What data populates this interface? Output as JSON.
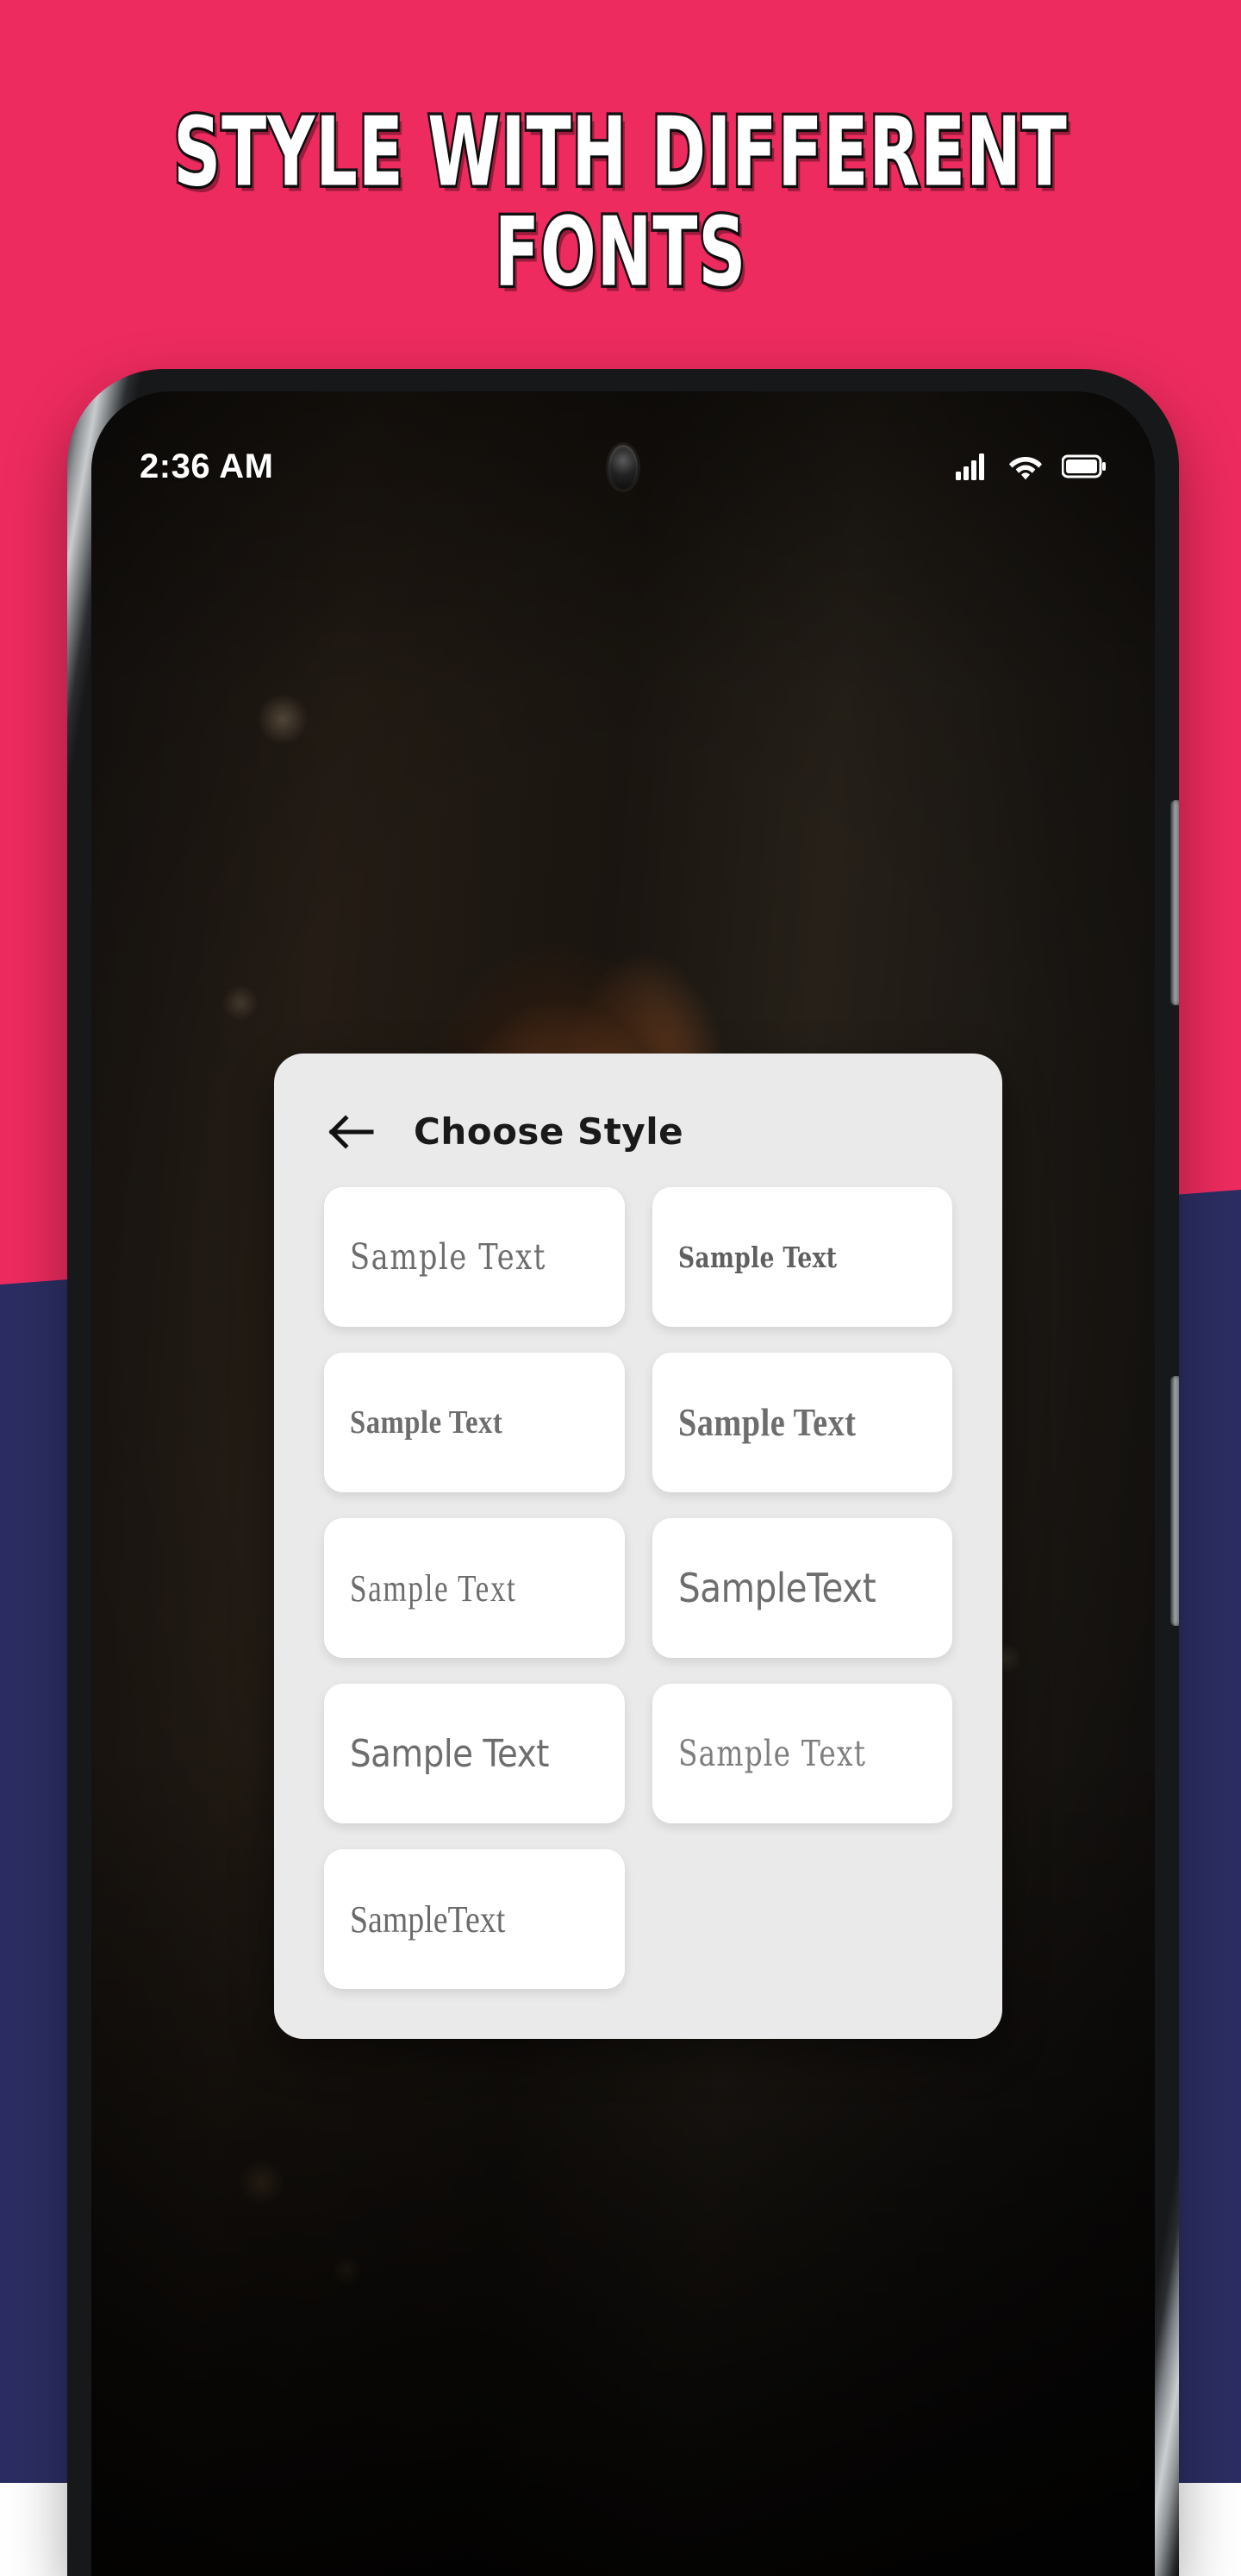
{
  "promo": {
    "headline": "STYLE WITH  DIFFERENT\nFONTS",
    "bg_top_color": "#ED2B5E",
    "bg_bottom_color": "#2C2E63"
  },
  "phone": {
    "status_bar": {
      "clock": "2:36 AM",
      "icons": [
        "signal-icon",
        "wifi-icon",
        "battery-icon"
      ]
    },
    "hardware": {
      "volume_button": "volume-rocker",
      "power_button": "power-button",
      "camera": "punch-hole-camera"
    }
  },
  "dialog": {
    "title": "Choose Style",
    "back_icon": "arrow-left-icon",
    "background_color": "#EAEAEA",
    "font_cards": [
      {
        "label": "Sample Text",
        "style_index": 0
      },
      {
        "label": "Sample Text",
        "style_index": 1
      },
      {
        "label": "Sample Text",
        "style_index": 2
      },
      {
        "label": "Sample Text",
        "style_index": 3
      },
      {
        "label": "Sample Text",
        "style_index": 4
      },
      {
        "label": "SampleText",
        "style_index": 5
      },
      {
        "label": "Sample Text",
        "style_index": 6
      },
      {
        "label": "Sample Text",
        "style_index": 7
      },
      {
        "label": "SampleText",
        "style_index": 8
      }
    ]
  }
}
